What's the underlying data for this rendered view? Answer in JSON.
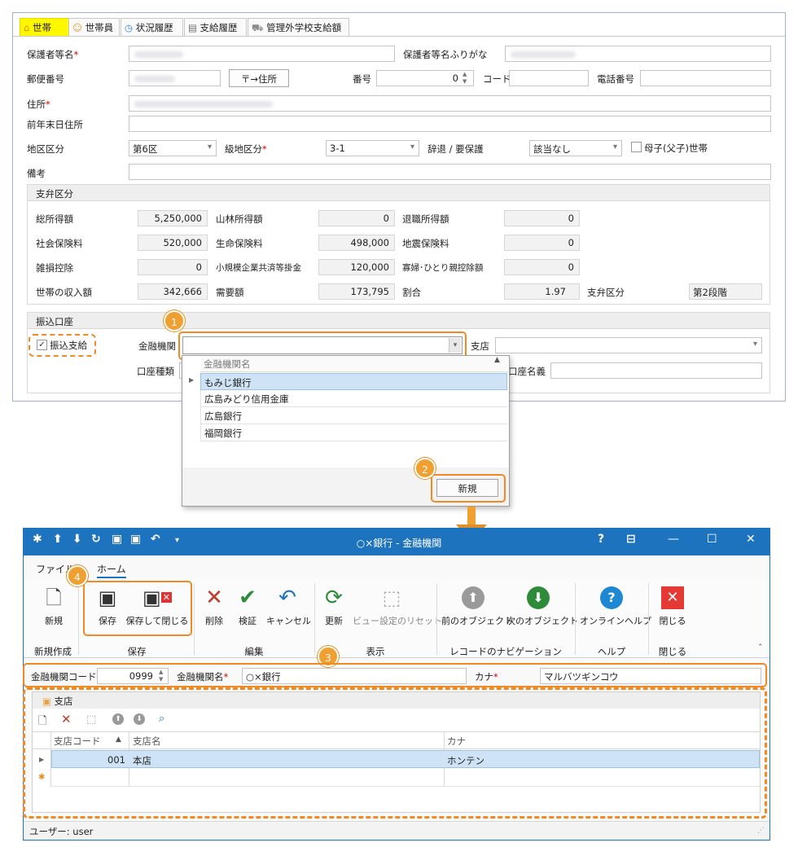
{
  "tabs": [
    {
      "label": "世帯",
      "icon": "home-icon"
    },
    {
      "label": "世帯員",
      "icon": "people-icon"
    },
    {
      "label": "状況履歴",
      "icon": "clock-icon"
    },
    {
      "label": "支給履歴",
      "icon": "list-icon"
    },
    {
      "label": "管理外学校支給額",
      "icon": "bus-icon"
    }
  ],
  "form": {
    "guardian_name_label": "保護者等名",
    "guardian_kana_label": "保護者等名ふりがな",
    "postal_label": "郵便番号",
    "postal_to_address_btn": "〒→住所",
    "number_label": "番号",
    "number_value": "0",
    "code_label": "コード",
    "phone_label": "電話番号",
    "address_label": "住所",
    "prev_address_label": "前年末日住所",
    "district_label": "地区区分",
    "district_value": "第6区",
    "grade_district_label": "級地区分",
    "grade_district_value": "3-1",
    "decline_label": "辞退 / 要保護",
    "decline_value": "該当なし",
    "single_parent_label": "母子(父子)世帯",
    "remarks_label": "備考"
  },
  "payment_section": {
    "title": "支弁区分",
    "rows": [
      [
        {
          "label": "総所得額",
          "value": "5,250,000"
        },
        {
          "label": "山林所得額",
          "value": "0"
        },
        {
          "label": "退職所得額",
          "value": "0"
        }
      ],
      [
        {
          "label": "社会保険料",
          "value": "520,000"
        },
        {
          "label": "生命保険料",
          "value": "498,000"
        },
        {
          "label": "地震保険料",
          "value": "0"
        }
      ],
      [
        {
          "label": "雑損控除",
          "value": "0"
        },
        {
          "label": "小規模企業共済等掛金",
          "value": "120,000"
        },
        {
          "label": "寡婦･ひとり親控除額",
          "value": "0"
        }
      ],
      [
        {
          "label": "世帯の収入額",
          "value": "342,666"
        },
        {
          "label": "需要額",
          "value": "173,795"
        },
        {
          "label": "割合",
          "value": "1.97"
        }
      ]
    ],
    "category_label": "支弁区分",
    "category_value": "第2段階"
  },
  "transfer": {
    "title": "振込口座",
    "checkbox_label": "振込支給",
    "bank_label": "金融機関",
    "branch_label": "支店",
    "account_type_label": "口座種類",
    "account_name_label": "口座名義"
  },
  "dropdown": {
    "column_header": "金融機関名",
    "items": [
      "もみじ銀行",
      "広島みどり信用金庫",
      "広島銀行",
      "福岡銀行"
    ],
    "new_button": "新規"
  },
  "badges": [
    "1",
    "2",
    "3",
    "4"
  ],
  "window": {
    "title": "○×銀行 - 金融機関",
    "menu": [
      "ファイル",
      "ホーム"
    ],
    "ribbon_buttons": {
      "new": "新規",
      "save": "保存",
      "save_close": "保存して閉じる",
      "delete": "削除",
      "validate": "検証",
      "cancel": "キャンセル",
      "refresh": "更新",
      "reset_view": "ビュー設定のリセット",
      "prev": "前のオブジェクト",
      "next": "次のオブジェクト",
      "help": "オンラインヘルプ",
      "close": "閉じる"
    },
    "ribbon_groups": [
      "新規作成",
      "保存",
      "編集",
      "表示",
      "レコードのナビゲーション",
      "ヘルプ",
      "閉じる"
    ],
    "bank_code_label": "金融機関コード",
    "bank_code_value": "0999",
    "bank_name_label": "金融機関名",
    "bank_name_value": "○×銀行",
    "kana_label": "カナ",
    "kana_value": "マルバツギンコウ",
    "branch_panel_title": "支店",
    "grid_headers": [
      "支店コード",
      "支店名",
      "カナ"
    ],
    "grid_rows": [
      {
        "code": "001",
        "name": "本店",
        "kana": "ホンテン"
      }
    ],
    "status": "ユーザー: user"
  },
  "colors": {
    "titlebar": "#1e73be",
    "accent_orange": "#f08a24",
    "selected_row": "#cfe3f7",
    "tab_highlight": "#fff800"
  }
}
